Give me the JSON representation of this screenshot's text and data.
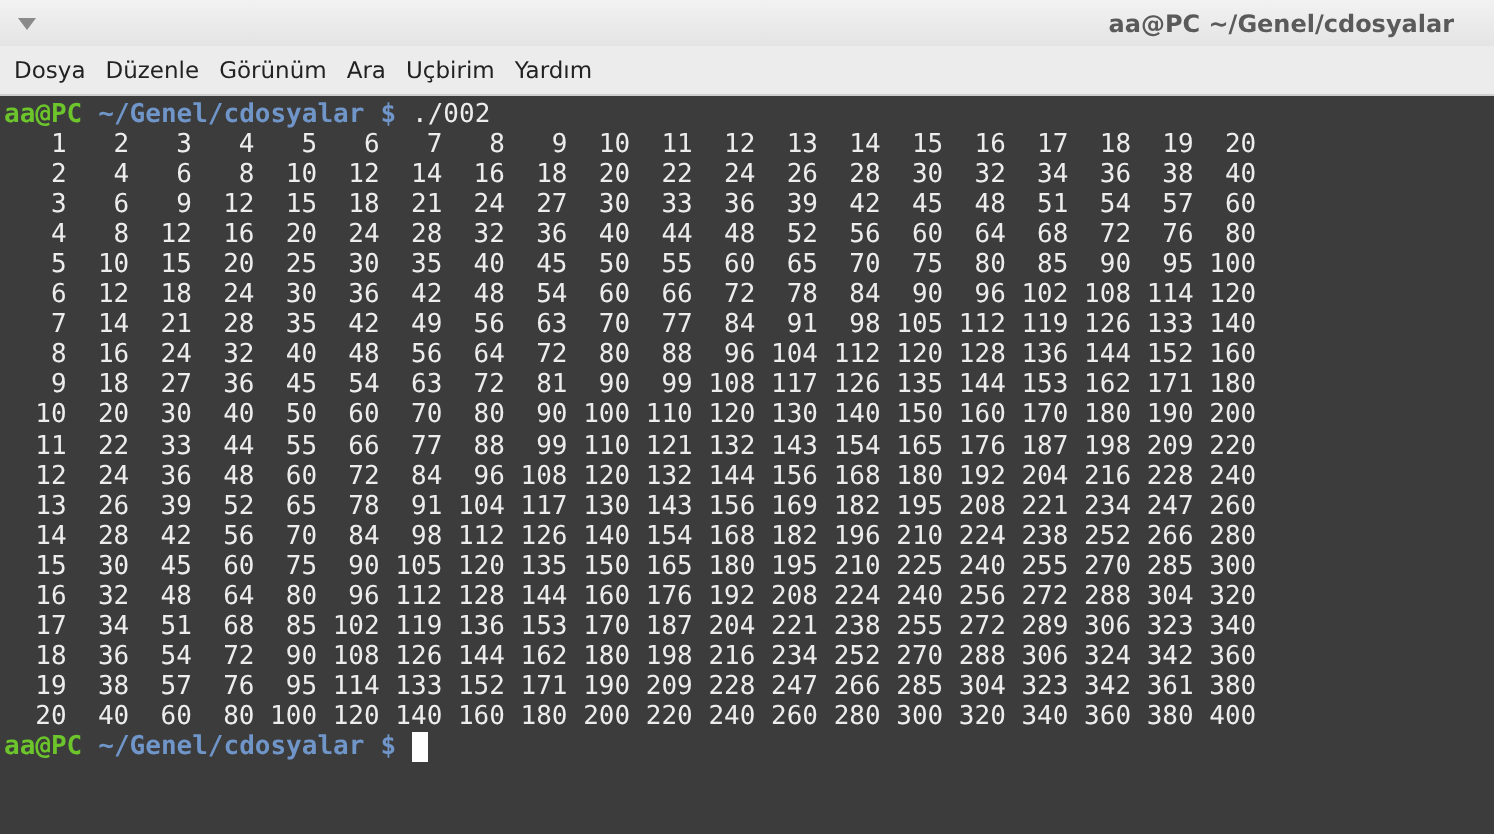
{
  "window": {
    "title": "aa@PC ~/Genel/cdosyalar"
  },
  "menu": [
    "Dosya",
    "Düzenle",
    "Görünüm",
    "Ara",
    "Uçbirim",
    "Yardım"
  ],
  "terminal": {
    "lines": [
      {
        "kind": "prompt",
        "user": "aa@PC",
        "path": "~/Genel/cdosyalar",
        "symbol": "$",
        "command": "./002"
      },
      {
        "kind": "output",
        "text": "   1   2   3   4   5   6   7   8   9  10  11  12  13  14  15  16  17  18  19  20"
      },
      {
        "kind": "output",
        "text": "   2   4   6   8  10  12  14  16  18  20  22  24  26  28  30  32  34  36  38  40"
      },
      {
        "kind": "output",
        "text": "   3   6   9  12  15  18  21  24  27  30  33  36  39  42  45  48  51  54  57  60"
      },
      {
        "kind": "output",
        "text": "   4   8  12  16  20  24  28  32  36  40  44  48  52  56  60  64  68  72  76  80"
      },
      {
        "kind": "output",
        "text": "   5  10  15  20  25  30  35  40  45  50  55  60  65  70  75  80  85  90  95 100"
      },
      {
        "kind": "output",
        "text": "   6  12  18  24  30  36  42  48  54  60  66  72  78  84  90  96 102 108 114 120"
      },
      {
        "kind": "output",
        "text": "   7  14  21  28  35  42  49  56  63  70  77  84  91  98 105 112 119 126 133 140"
      },
      {
        "kind": "output",
        "text": "   8  16  24  32  40  48  56  64  72  80  88  96 104 112 120 128 136 144 152 160"
      },
      {
        "kind": "output",
        "text": "   9  18  27  36  45  54  63  72  81  90  99 108 117 126 135 144 153 162 171 180"
      },
      {
        "kind": "output",
        "text": "  10  20  30  40  50  60  70  80  90 100 110 120 130 140 150 160 170 180 190 200"
      },
      {
        "kind": "output",
        "text": "  11  22  33  44  55  66  77  88  99 110 121 132 143 154 165 176 187 198 209 220"
      },
      {
        "kind": "output",
        "text": "  12  24  36  48  60  72  84  96 108 120 132 144 156 168 180 192 204 216 228 240"
      },
      {
        "kind": "output",
        "text": "  13  26  39  52  65  78  91 104 117 130 143 156 169 182 195 208 221 234 247 260"
      },
      {
        "kind": "output",
        "text": "  14  28  42  56  70  84  98 112 126 140 154 168 182 196 210 224 238 252 266 280"
      },
      {
        "kind": "output",
        "text": "  15  30  45  60  75  90 105 120 135 150 165 180 195 210 225 240 255 270 285 300"
      },
      {
        "kind": "output",
        "text": "  16  32  48  64  80  96 112 128 144 160 176 192 208 224 240 256 272 288 304 320"
      },
      {
        "kind": "output",
        "text": "  17  34  51  68  85 102 119 136 153 170 187 204 221 238 255 272 289 306 323 340"
      },
      {
        "kind": "output",
        "text": "  18  36  54  72  90 108 126 144 162 180 198 216 234 252 270 288 306 324 342 360"
      },
      {
        "kind": "output",
        "text": "  19  38  57  76  95 114 133 152 171 190 209 228 247 266 285 304 323 342 361 380"
      },
      {
        "kind": "output",
        "text": "  20  40  60  80 100 120 140 160 180 200 220 240 260 280 300 320 340 360 380 400"
      },
      {
        "kind": "prompt",
        "user": "aa@PC",
        "path": "~/Genel/cdosyalar",
        "symbol": "$",
        "cursor": true
      }
    ]
  }
}
